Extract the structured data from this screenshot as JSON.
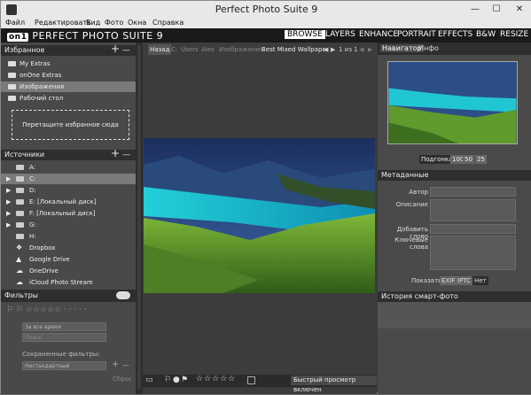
{
  "window": {
    "title": "Perfect Photo Suite 9",
    "minimize": "—",
    "maximize": "☐",
    "close": "✕"
  },
  "menu": [
    "Файл",
    "Редактировать",
    "Вид",
    "Фото",
    "Окна",
    "Справка"
  ],
  "brand": {
    "logo_mark": "on1",
    "logo_text": "PERFECT PHOTO SUITE 9"
  },
  "modules": [
    "BROWSE",
    "LAYERS",
    "ENHANCE",
    "PORTRAIT",
    "EFFECTS",
    "B&W",
    "RESIZE"
  ],
  "favorites": {
    "header": "Избранное",
    "items": [
      {
        "label": "My Extras",
        "selected": false
      },
      {
        "label": "onOne Extras",
        "selected": false
      },
      {
        "label": "Изображения",
        "selected": true
      },
      {
        "label": "Рабочий стол",
        "selected": false
      }
    ],
    "drop_hint": "Перетащите избранное сюда"
  },
  "sources": {
    "header": "Источники",
    "drives": [
      {
        "label": "A:",
        "expandable": false,
        "selected": false
      },
      {
        "label": "C:",
        "expandable": true,
        "selected": true
      },
      {
        "label": "D:",
        "expandable": true,
        "selected": false
      },
      {
        "label": "E: [Локальный диск]",
        "expandable": true,
        "selected": false
      },
      {
        "label": "F: [Локальный диск]",
        "expandable": true,
        "selected": false
      },
      {
        "label": "G:",
        "expandable": true,
        "selected": false
      },
      {
        "label": "H:",
        "expandable": false,
        "selected": false
      }
    ],
    "cloud": [
      "Dropbox",
      "Google Drive",
      "OneDrive",
      "iCloud Photo Stream"
    ]
  },
  "filters": {
    "header": "Фильтры",
    "time": "За все время",
    "search_placeholder": "Поиск",
    "saved_label": "Сохраненные фильтры:",
    "saved_value": "Нестандартный",
    "reset": "Сброс"
  },
  "path": {
    "back": "Назад",
    "segments": [
      "C:",
      "Users",
      "Alex",
      "Изображения",
      "Best Mixed Wallpape"
    ],
    "counter": "1 из 1"
  },
  "bottom": {
    "preview_status": "Быстрый просмотр включен"
  },
  "navigator": {
    "tabs": [
      "Навигатор",
      "Инфо"
    ],
    "fit": "Подгонка",
    "zooms": [
      "100",
      "50",
      "25"
    ]
  },
  "metadata": {
    "header": "Метаданные",
    "fields": [
      "Автор",
      "Описание",
      "Добавить слово",
      "Ключевые слова"
    ],
    "show_label": "Показать",
    "show_options": [
      "EXIF",
      "IPTC",
      "Нет"
    ]
  },
  "history": {
    "header": "История смарт-фото"
  },
  "colors": {
    "panel": "#494949",
    "header": "#2e2e2e",
    "selected": "#7a7a7a",
    "accent_tab": "#ffffff"
  }
}
